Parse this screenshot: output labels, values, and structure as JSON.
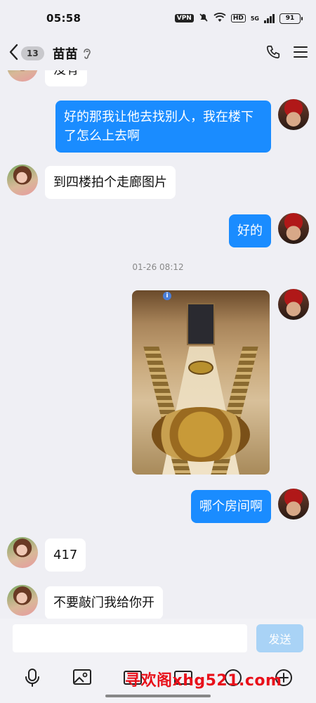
{
  "status_bar": {
    "time": "05:58",
    "vpn": "VPN",
    "hd": "HD",
    "network": "5G",
    "battery": "91"
  },
  "header": {
    "unread_count": "13",
    "contact_name": "苗苗",
    "icons": [
      "back-icon",
      "ear-icon",
      "phone-icon",
      "menu-icon"
    ]
  },
  "messages": [
    {
      "side": "in",
      "text": "没有"
    },
    {
      "side": "out",
      "text": "好的那我让他去找别人，我在楼下了怎么上去啊"
    },
    {
      "side": "in",
      "text": "到四楼拍个走廊图片"
    },
    {
      "side": "out",
      "text": "好的"
    },
    {
      "type": "timestamp",
      "text": "01-26 08:12"
    },
    {
      "side": "out",
      "type": "image"
    },
    {
      "side": "out",
      "text": "哪个房间啊"
    },
    {
      "side": "in",
      "text": "417"
    },
    {
      "side": "in",
      "text": "不要敲门我给你开"
    }
  ],
  "input": {
    "placeholder": "",
    "send_label": "发送"
  },
  "toolbar": {
    "icons": [
      "microphone-icon",
      "gallery-icon",
      "image-icon",
      "camera-icon",
      "emoji-icon",
      "plus-icon"
    ]
  },
  "watermark": "寻欢阁xhg521.com",
  "colors": {
    "out_bubble": "#1a8cff",
    "in_bubble": "#ffffff",
    "background": "#efeff4",
    "send_button": "#a9d3f6"
  }
}
